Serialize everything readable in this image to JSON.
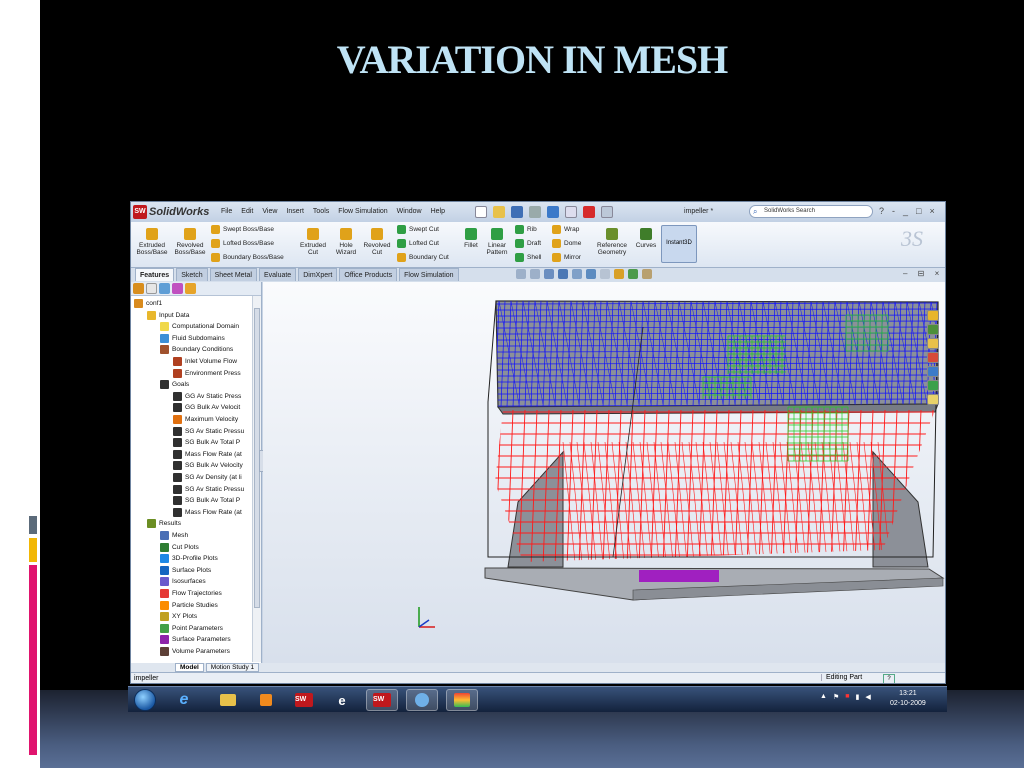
{
  "slide": {
    "title": "VARIATION IN MESH"
  },
  "window": {
    "app_logo": "SolidWorks",
    "menu": [
      "File",
      "Edit",
      "View",
      "Insert",
      "Tools",
      "Flow Simulation",
      "Window",
      "Help"
    ],
    "document_name": "impeller *",
    "search_placeholder": "SolidWorks Search",
    "controls": [
      "?",
      "-",
      "_",
      "□",
      "×"
    ]
  },
  "command_manager": {
    "big_buttons": [
      {
        "label": "Extruded Boss/Base",
        "color": "#e0a21a"
      },
      {
        "label": "Revolved Boss/Base",
        "color": "#e0a21a"
      },
      {
        "label": "Extruded Cut",
        "color": "#e0a21a"
      },
      {
        "label": "Hole Wizard",
        "color": "#e0a21a"
      },
      {
        "label": "Revolved Cut",
        "color": "#e0a21a"
      },
      {
        "label": "Fillet",
        "color": "#2f9e44"
      },
      {
        "label": "Linear Pattern",
        "color": "#2f9e44"
      },
      {
        "label": "Reference Geometry",
        "color": "#6a8f2c"
      },
      {
        "label": "Curves",
        "color": "#3f7d2a"
      }
    ],
    "small_buttons": [
      {
        "label": "Swept Boss/Base",
        "color": "#e0a21a"
      },
      {
        "label": "Lofted Boss/Base",
        "color": "#e0a21a"
      },
      {
        "label": "Boundary Boss/Base",
        "color": "#e0a21a"
      },
      {
        "label": "Swept Cut",
        "color": "#2f9e44"
      },
      {
        "label": "Lofted Cut",
        "color": "#2f9e44"
      },
      {
        "label": "Boundary Cut",
        "color": "#2f9e44"
      },
      {
        "label": "Rib",
        "color": "#2f9e44"
      },
      {
        "label": "Draft",
        "color": "#2f9e44"
      },
      {
        "label": "Shell",
        "color": "#2f9e44"
      },
      {
        "label": "Wrap",
        "color": "#e0a21a"
      },
      {
        "label": "Dome",
        "color": "#e0a21a"
      },
      {
        "label": "Mirror",
        "color": "#e0a21a"
      }
    ],
    "instant3d_label": "Instant3D",
    "tabs": [
      "Features",
      "Sketch",
      "Sheet Metal",
      "Evaluate",
      "DimXpert",
      "Office Products",
      "Flow Simulation"
    ],
    "active_tab": "Features"
  },
  "tree": {
    "items": [
      {
        "label": "conf1",
        "indent": 0,
        "color": "#d98b1e"
      },
      {
        "label": "Input Data",
        "indent": 1,
        "color": "#e8b72c"
      },
      {
        "label": "Computational Domain",
        "indent": 2,
        "color": "#f0d84a"
      },
      {
        "label": "Fluid Subdomains",
        "indent": 2,
        "color": "#3c8fd6"
      },
      {
        "label": "Boundary Conditions",
        "indent": 2,
        "color": "#a0522d"
      },
      {
        "label": "Inlet Volume Flow",
        "indent": 3,
        "color": "#b04020"
      },
      {
        "label": "Environment Press",
        "indent": 3,
        "color": "#b04020"
      },
      {
        "label": "Goals",
        "indent": 2,
        "color": "#303030"
      },
      {
        "label": "GG Av Static Press",
        "indent": 3,
        "color": "#303030"
      },
      {
        "label": "GG Bulk Av Velocit",
        "indent": 3,
        "color": "#303030"
      },
      {
        "label": "Maximum Velocity",
        "indent": 3,
        "color": "#e07010"
      },
      {
        "label": "SG Av Static Pressu",
        "indent": 3,
        "color": "#303030"
      },
      {
        "label": "SG Bulk Av Total P",
        "indent": 3,
        "color": "#303030"
      },
      {
        "label": "Mass Flow Rate (at",
        "indent": 3,
        "color": "#303030"
      },
      {
        "label": "SG Bulk Av Velocity",
        "indent": 3,
        "color": "#303030"
      },
      {
        "label": "SG Av Density (at li",
        "indent": 3,
        "color": "#303030"
      },
      {
        "label": "SG Av Static Pressu",
        "indent": 3,
        "color": "#303030"
      },
      {
        "label": "SG Bulk Av Total P",
        "indent": 3,
        "color": "#303030"
      },
      {
        "label": "Mass Flow Rate (at",
        "indent": 3,
        "color": "#303030"
      },
      {
        "label": "Results",
        "indent": 1,
        "color": "#6b8e23"
      },
      {
        "label": "Mesh",
        "indent": 2,
        "color": "#4a6fb5"
      },
      {
        "label": "Cut Plots",
        "indent": 2,
        "color": "#2e7d32"
      },
      {
        "label": "3D-Profile Plots",
        "indent": 2,
        "color": "#1e88e5"
      },
      {
        "label": "Surface Plots",
        "indent": 2,
        "color": "#1565c0"
      },
      {
        "label": "Isosurfaces",
        "indent": 2,
        "color": "#6a5acd"
      },
      {
        "label": "Flow Trajectories",
        "indent": 2,
        "color": "#e53935"
      },
      {
        "label": "Particle Studies",
        "indent": 2,
        "color": "#fb8c00"
      },
      {
        "label": "XY Plots",
        "indent": 2,
        "color": "#c0a020"
      },
      {
        "label": "Point Parameters",
        "indent": 2,
        "color": "#43a047"
      },
      {
        "label": "Surface Parameters",
        "indent": 2,
        "color": "#8e24aa"
      },
      {
        "label": "Volume Parameters",
        "indent": 2,
        "color": "#5d4037"
      }
    ]
  },
  "model_tabs": [
    "Model",
    "Motion Study 1"
  ],
  "status": {
    "left": "impeller",
    "right": "Editing Part"
  },
  "taskbar": {
    "clock_time": "13:21",
    "clock_date": "02-10-2009"
  },
  "colors": {
    "mesh_upper": "#1010ff",
    "mesh_lower": "#ff1a1a",
    "mesh_refined": "#22cc22",
    "outlet": "#a020c0"
  }
}
